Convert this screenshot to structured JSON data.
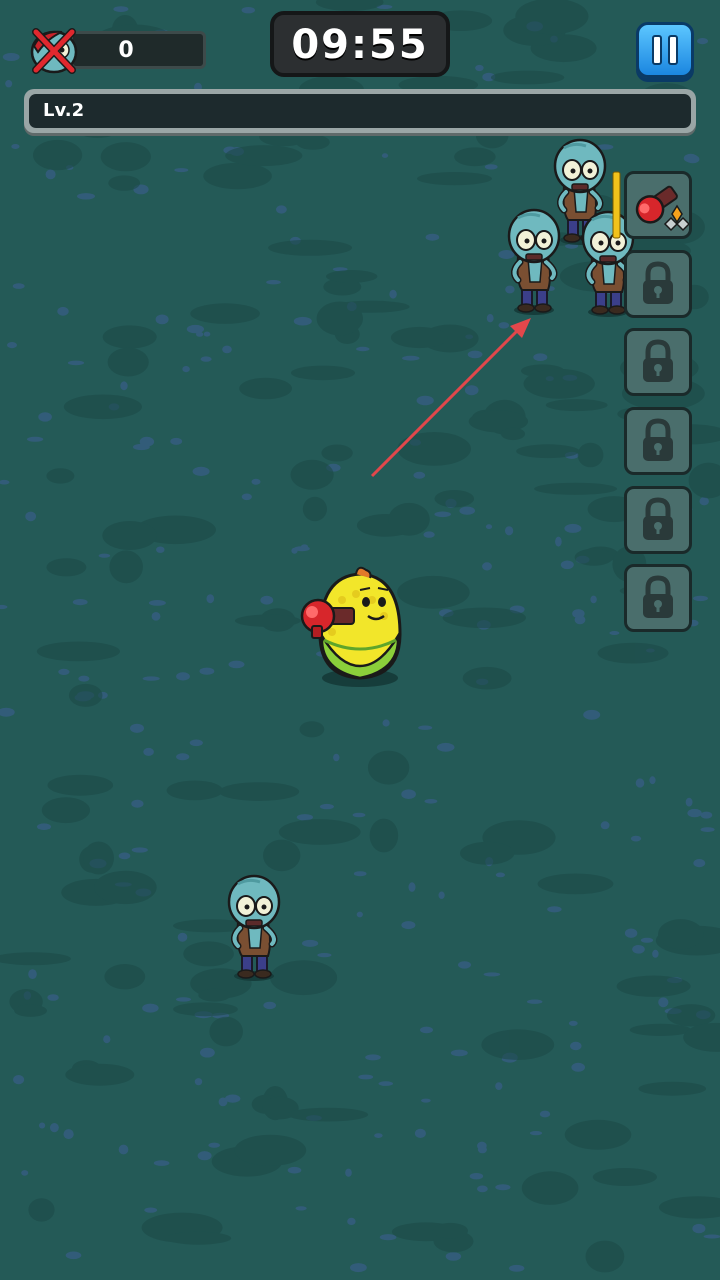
{
  "hud": {
    "kill_count": "0",
    "timer": "09:55",
    "level_label": "Lv.2",
    "xp_progress": 0,
    "pause_icon": "pause-icon",
    "kill_icon": "crossed-zombie-head-icon"
  },
  "skills": {
    "slots": [
      {
        "state": "equipped",
        "icon": "red-blaster-icon"
      },
      {
        "state": "locked",
        "icon": "lock-icon"
      },
      {
        "state": "locked",
        "icon": "lock-icon"
      },
      {
        "state": "locked",
        "icon": "lock-icon"
      },
      {
        "state": "locked",
        "icon": "lock-icon"
      },
      {
        "state": "locked",
        "icon": "lock-icon"
      }
    ]
  },
  "colors": {
    "ground": "#245a57",
    "aim_arrow": "#e2474b",
    "player": "#f2e62a",
    "zombie": "#6fb9bf"
  }
}
